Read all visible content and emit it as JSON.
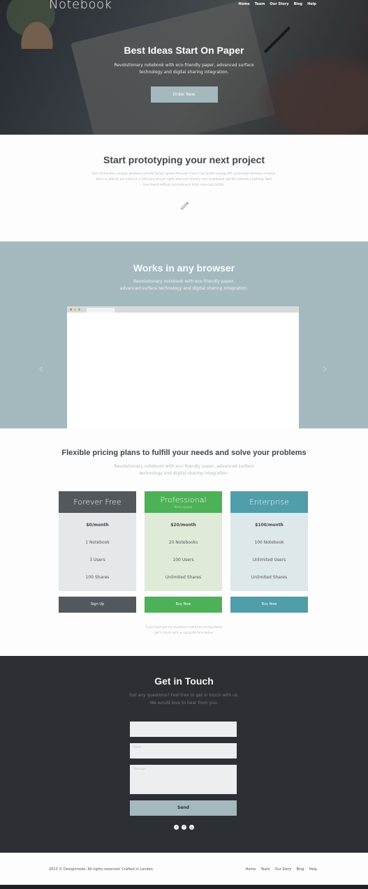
{
  "brand": "Notebook",
  "nav": [
    "Home",
    "Team",
    "Our Story",
    "Blog",
    "Help"
  ],
  "hero": {
    "title": "Best Ideas Start On Paper",
    "subtitle_line1": "Revolutionary notebook with eco-friendly paper, advanced surface",
    "subtitle_line2": "technology and digital sharing integration.",
    "cta": "Order Now"
  },
  "prototype": {
    "title": "Start prototyping your next project",
    "text_line1": "Terry Richardson cardigan whatever gentrify Tumblr, gluten-free jean shorts cray Schlitz selvage DIY sustainable Helvetica sriracha.",
    "text_line2": "Banh mi ethical, put a bird on it VHS irony bicycle rights slow-carb literally retro skateboard ugh 90's Helvetica hashtag. Next",
    "text_line3": "level beard keffiyeh cornhole pork belly, slow-carb Schlitz.",
    "icon": "pencil-icon"
  },
  "browser": {
    "title": "Works in any browser",
    "subtitle_line1": "Revolutionary notebook with eco-friendly paper,",
    "subtitle_line2": "advanced surface technology and digital sharing integration.",
    "prev": "‹",
    "next": "›"
  },
  "pricing": {
    "title": "Flexible pricing plans to fulfill your needs and solve your problems",
    "subtitle_line1": "Revolutionary notebook with eco-friendly paper, advanced surface",
    "subtitle_line2": "technology and digital sharing integration.",
    "plans": [
      {
        "name": "Forever Free",
        "popular": "",
        "price": "$0/month",
        "notebooks": "1 Notebook",
        "users": "3 Users",
        "shares": "100 Shares",
        "button": "Sign Up"
      },
      {
        "name": "Professional",
        "popular": "Most popular",
        "price": "$20/month",
        "notebooks": "20 Notebooks",
        "users": "100 Users",
        "shares": "Unlimited Shares",
        "button": "Buy Now"
      },
      {
        "name": "Enterprise",
        "popular": "",
        "price": "$100/month",
        "notebooks": "100 Notebook",
        "users": "Unlimited Users",
        "shares": "Unlimited Shares",
        "button": "Buy Now"
      }
    ],
    "note_line1": "If you have got any questions related to pricing please",
    "note_line2": "get in touch with us using the form below."
  },
  "contact": {
    "title": "Get in Touch",
    "subtitle_line1": "Got any questions? Feel free to get in touch with us.",
    "subtitle_line2": "We would love to hear from you.",
    "name_placeholder": "",
    "email_placeholder": "Email",
    "message_placeholder": "Message",
    "send": "Send",
    "social": [
      "twitter-icon",
      "facebook-icon",
      "dribbble-icon"
    ]
  },
  "footer": {
    "copyright": "2013 © Designmodo. All rights reserved. Crafted in London.",
    "nav": [
      "Home",
      "Team",
      "Our Story",
      "Blog",
      "Help"
    ]
  },
  "colors": {
    "accent": "#a4b9be",
    "dark": "#2c2f34",
    "free": "#53585d",
    "pro": "#4cb157",
    "enterprise": "#4f9ea9"
  }
}
